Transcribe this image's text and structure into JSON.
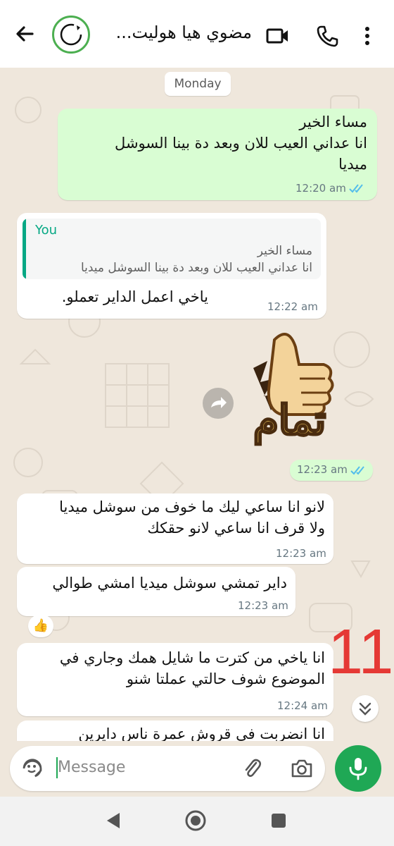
{
  "header": {
    "title": "مضوي هيا هوليت...",
    "back_icon": "arrow-left-icon",
    "video_icon": "video-call-icon",
    "call_icon": "phone-icon",
    "menu_icon": "more-vert-icon"
  },
  "chat": {
    "day_label": "Monday",
    "messages": [
      {
        "dir": "out",
        "text": "مساء الخير\nانا عداني العيب للان وبعد دة بينا السوشل\nميديا",
        "time": "12:20 am",
        "read": true
      },
      {
        "dir": "in",
        "quote_name": "You",
        "quote_text": "مساء الخير\nانا عداني العيب للان وبعد دة بينا السوشل ميديا",
        "text": "ياخي اعمل الداير تعملو.",
        "time": "12:22 am"
      },
      {
        "dir": "out",
        "sticker_text": "تمام",
        "time": "12:23 am",
        "read": true
      },
      {
        "dir": "in",
        "text": "لانو انا ساعي ليك ما خوف من سوشل ميديا\nولا قرف انا ساعي لانو حقكك",
        "time": "12:23 am"
      },
      {
        "dir": "in",
        "text": "داير تمشي سوشل ميديا امشي طوالي",
        "time": "12:23 am",
        "reaction": "👍"
      },
      {
        "dir": "in",
        "text": "انا ياخي من كترت ما شايل همك وجاري في\nالموضوع شوف حالتي عملتا شنو",
        "time": "12:24 am"
      },
      {
        "dir": "in",
        "text": "انا انضربت في قروش عمرة ناس دايرين",
        "time": ""
      }
    ],
    "unread_count": "11"
  },
  "composer": {
    "placeholder": "Message",
    "emoji_icon": "sticker-icon",
    "attach_icon": "paperclip-icon",
    "camera_icon": "camera-icon",
    "mic_icon": "mic-icon"
  },
  "colors": {
    "accent": "#1fa855",
    "outgoing_bubble": "#d9fdd3",
    "chat_bg": "#efe7dc",
    "tick_blue": "#53bdeb"
  }
}
